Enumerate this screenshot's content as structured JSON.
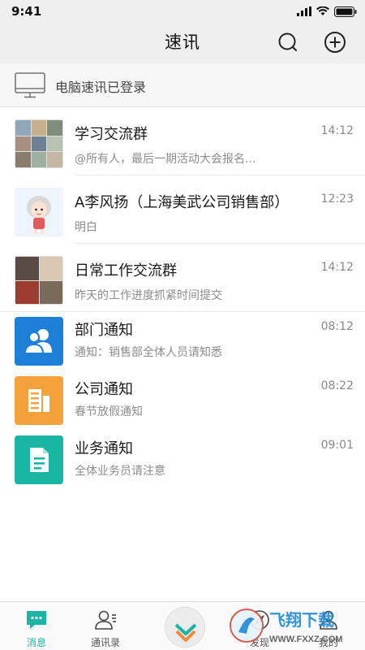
{
  "status": {
    "time": "9:41"
  },
  "header": {
    "title": "速讯"
  },
  "login_banner": {
    "text": "电脑速讯已登录"
  },
  "conversations": [
    {
      "name": "学习交流群",
      "preview": "@所有人，最后一期活动大会报名...",
      "time": "14:12",
      "avatar": "group-grid"
    },
    {
      "name": "A李风扬（上海美武公司销售部）",
      "preview": "明白",
      "time": "12:23",
      "avatar": "cartoon-person"
    },
    {
      "name": "日常工作交流群",
      "preview": "昨天的工作进度抓紧时间提交",
      "time": "14:12",
      "avatar": "group-grid-2"
    },
    {
      "name": "部门通知",
      "preview": "通知：销售部全体人员请知悉",
      "time": "08:12",
      "avatar": "people-icon",
      "color": "#1e7fd8"
    },
    {
      "name": "公司通知",
      "preview": "春节放假通知",
      "time": "08:22",
      "avatar": "building-icon",
      "color": "#f5a13c"
    },
    {
      "name": "业务通知",
      "preview": "全体业务员请注意",
      "time": "09:01",
      "avatar": "document-icon",
      "color": "#1bb5a4"
    }
  ],
  "tabs": [
    {
      "label": "消息",
      "icon": "message-icon",
      "active": true
    },
    {
      "label": "通讯录",
      "icon": "contacts-icon",
      "active": false
    },
    {
      "label": "",
      "icon": "app-logo-icon",
      "active": false
    },
    {
      "label": "发现",
      "icon": "discover-icon",
      "active": false
    },
    {
      "label": "我的",
      "icon": "profile-icon",
      "active": false
    }
  ],
  "watermark": {
    "text": "飞翔下载",
    "url_text": "WWW.FXXZ.COM"
  },
  "colors": {
    "accent": "#1bb5a4",
    "bar_bg": "#efefef"
  }
}
